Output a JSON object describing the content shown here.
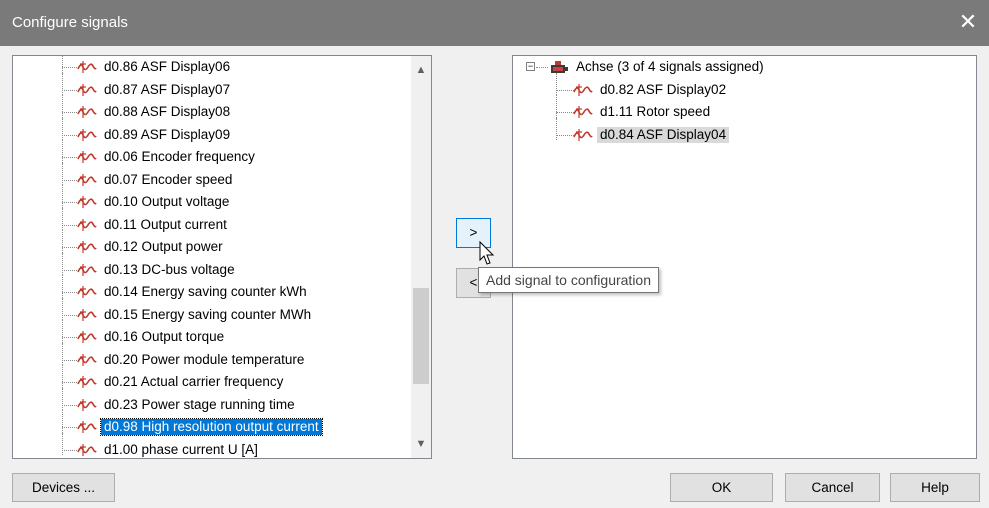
{
  "window": {
    "title": "Configure signals",
    "close_glyph": "✕"
  },
  "left_list": {
    "items": [
      {
        "label": "d0.86 ASF Display06"
      },
      {
        "label": "d0.87 ASF Display07"
      },
      {
        "label": "d0.88 ASF Display08"
      },
      {
        "label": "d0.89 ASF Display09"
      },
      {
        "label": "d0.06 Encoder frequency"
      },
      {
        "label": "d0.07 Encoder speed"
      },
      {
        "label": "d0.10 Output voltage"
      },
      {
        "label": "d0.11 Output current"
      },
      {
        "label": "d0.12 Output power"
      },
      {
        "label": "d0.13 DC-bus voltage"
      },
      {
        "label": "d0.14 Energy saving counter kWh"
      },
      {
        "label": "d0.15 Energy saving counter MWh"
      },
      {
        "label": "d0.16 Output torque"
      },
      {
        "label": "d0.20 Power module temperature"
      },
      {
        "label": "d0.21 Actual carrier frequency"
      },
      {
        "label": "d0.23 Power stage running time"
      },
      {
        "label": "d0.98 High resolution output current",
        "selected": true
      },
      {
        "label": "d1.00 phase current U [A]"
      }
    ],
    "scroll_up_glyph": "▲",
    "scroll_down_glyph": "▼"
  },
  "transfer": {
    "add_label": ">",
    "remove_label": "<",
    "add_tooltip": "Add signal to configuration"
  },
  "right_tree": {
    "expander_glyph": "−",
    "device": {
      "label": "Achse (3 of 4 signals assigned)",
      "icon": "device-icon"
    },
    "signals": [
      {
        "label": "d0.82 ASF Display02"
      },
      {
        "label": "d1.11 Rotor speed"
      },
      {
        "label": "d0.84 ASF Display04",
        "selected": true
      }
    ]
  },
  "footer": {
    "devices_label": "Devices ...",
    "ok_label": "OK",
    "cancel_label": "Cancel",
    "help_label": "Help"
  },
  "colors": {
    "titlebar": "#7a7a7a",
    "selection": "#0078d7",
    "signal_icon": "#c0392b"
  }
}
